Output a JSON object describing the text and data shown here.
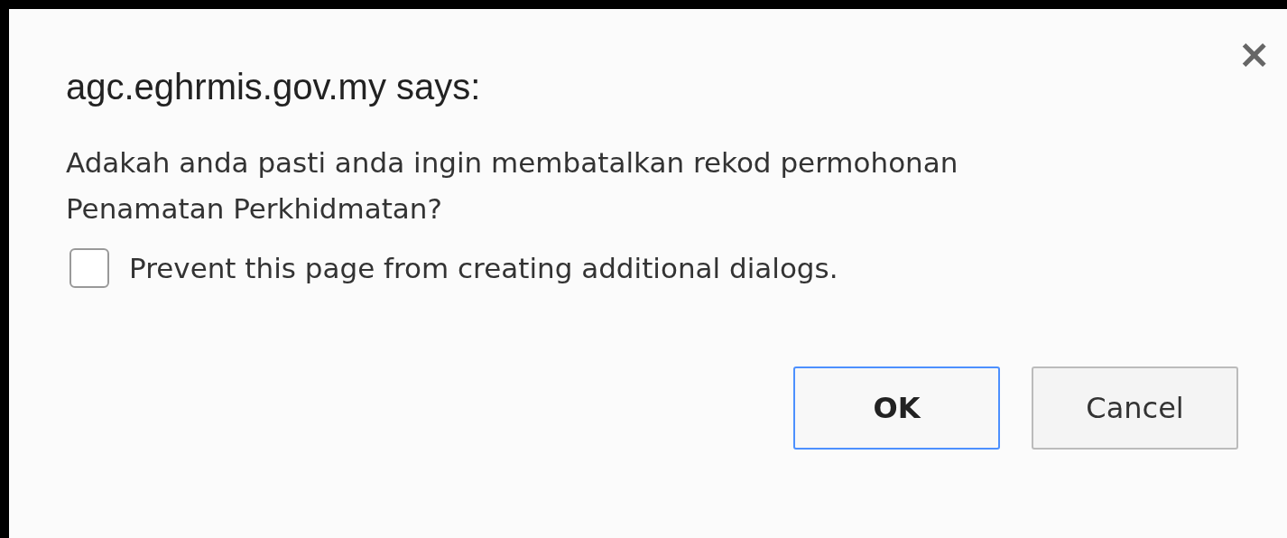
{
  "dialog": {
    "title": "agc.eghrmis.gov.my says:",
    "close": "×",
    "message": "Adakah anda pasti anda ingin membatalkan rekod permohonan Penamatan Perkhidmatan?",
    "checkbox": {
      "label": "Prevent this page from creating additional dialogs.",
      "checked": false
    },
    "buttons": [
      {
        "label": "OK",
        "kind": "default"
      },
      {
        "label": "Cancel",
        "kind": "normal"
      }
    ]
  }
}
